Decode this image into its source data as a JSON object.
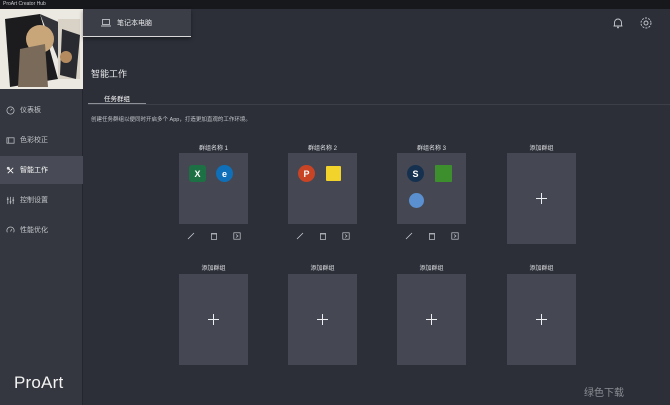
{
  "window": {
    "title": "ProArt Creator Hub"
  },
  "sidebar": {
    "items": [
      {
        "label": "仪表板",
        "icon": "gauge-icon"
      },
      {
        "label": "色彩校正",
        "icon": "color-palette-icon"
      },
      {
        "label": "智能工作",
        "icon": "smart-work-icon",
        "active": true
      },
      {
        "label": "控制设置",
        "icon": "sliders-icon"
      },
      {
        "label": "性能优化",
        "icon": "performance-icon"
      }
    ],
    "logo": "ProArt"
  },
  "topbar": {
    "device_tab": "笔记本电脑",
    "icons": [
      "bell-icon",
      "gear-icon"
    ]
  },
  "main": {
    "title": "智能工作",
    "subtab": "任务群组",
    "description": "创建任务群组以便同时开启多个 App，打造更加直观的工作环境。",
    "groups": [
      {
        "label": "群组名称 1",
        "apps": [
          "excel-icon",
          "edge-icon"
        ]
      },
      {
        "label": "群组名称 2",
        "apps": [
          "powerpoint-icon",
          "sticky-notes-icon"
        ]
      },
      {
        "label": "群组名称 3",
        "apps": [
          "steam-icon",
          "nvidia-icon",
          "paint-icon"
        ]
      },
      {
        "label": "添加群组"
      }
    ],
    "add_groups": [
      "添加群组",
      "添加群组",
      "添加群组",
      "添加群组"
    ],
    "watermark": "绿色下载"
  },
  "colors": {
    "background": "#2c2f38",
    "sidebar": "#34373f",
    "card": "#454852",
    "active": "#484b55"
  }
}
